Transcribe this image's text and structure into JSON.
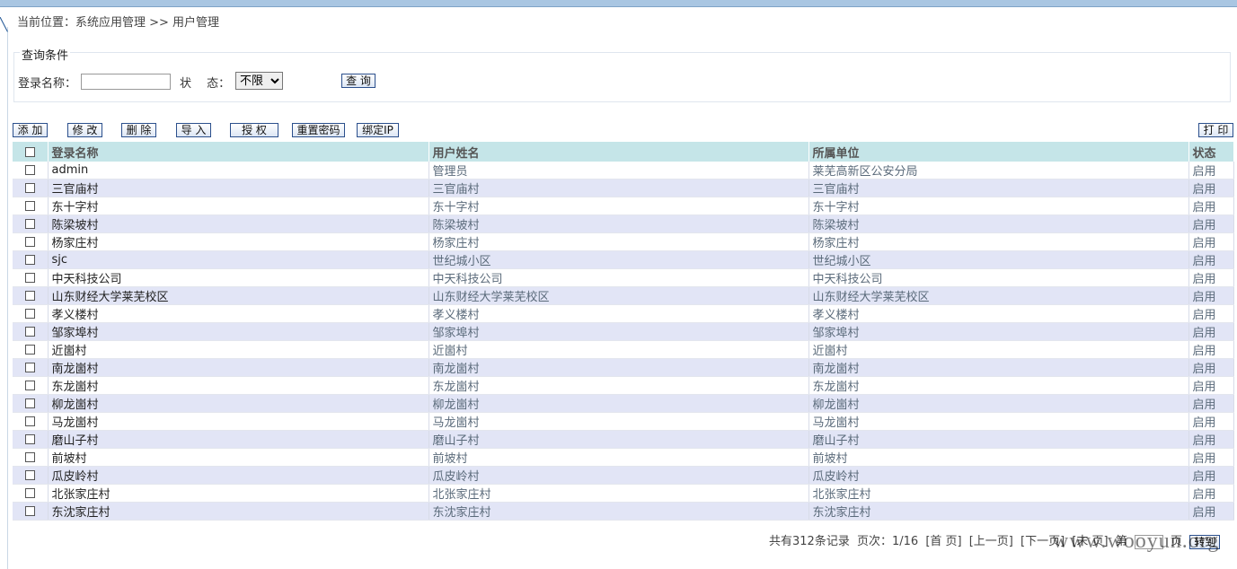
{
  "breadcrumb": "当前位置：系统应用管理 >> 用户管理",
  "query": {
    "legend": "查询条件",
    "login_label": "登录名称：",
    "login_value": "",
    "status_label": "状　 态：",
    "status_selected": "不限",
    "search_button": "查 询"
  },
  "toolbar": {
    "add": "添 加",
    "edit": "修 改",
    "delete": "删 除",
    "import": "导 入",
    "authorize": "授 权",
    "reset_password": "重置密码",
    "bind_ip": "绑定IP",
    "print": "打 印"
  },
  "table": {
    "headers": [
      "登录名称",
      "用户姓名",
      "所属单位",
      "状态"
    ],
    "rows": [
      [
        "admin",
        "管理员",
        "莱芜高新区公安分局",
        "启用"
      ],
      [
        "三官庙村",
        "三官庙村",
        "三官庙村",
        "启用"
      ],
      [
        "东十字村",
        "东十字村",
        "东十字村",
        "启用"
      ],
      [
        "陈梁坡村",
        "陈梁坡村",
        "陈梁坡村",
        "启用"
      ],
      [
        "杨家庄村",
        "杨家庄村",
        "杨家庄村",
        "启用"
      ],
      [
        "sjc",
        "世纪城小区",
        "世纪城小区",
        "启用"
      ],
      [
        "中天科技公司",
        "中天科技公司",
        "中天科技公司",
        "启用"
      ],
      [
        "山东财经大学莱芜校区",
        "山东财经大学莱芜校区",
        "山东财经大学莱芜校区",
        "启用"
      ],
      [
        "孝义楼村",
        "孝义楼村",
        "孝义楼村",
        "启用"
      ],
      [
        "邹家埠村",
        "邹家埠村",
        "邹家埠村",
        "启用"
      ],
      [
        "近崮村",
        "近崮村",
        "近崮村",
        "启用"
      ],
      [
        "南龙崮村",
        "南龙崮村",
        "南龙崮村",
        "启用"
      ],
      [
        "东龙崮村",
        "东龙崮村",
        "东龙崮村",
        "启用"
      ],
      [
        "柳龙崮村",
        "柳龙崮村",
        "柳龙崮村",
        "启用"
      ],
      [
        "马龙崮村",
        "马龙崮村",
        "马龙崮村",
        "启用"
      ],
      [
        "磨山子村",
        "磨山子村",
        "磨山子村",
        "启用"
      ],
      [
        "前坡村",
        "前坡村",
        "前坡村",
        "启用"
      ],
      [
        "瓜皮岭村",
        "瓜皮岭村",
        "瓜皮岭村",
        "启用"
      ],
      [
        "北张家庄村",
        "北张家庄村",
        "北张家庄村",
        "启用"
      ],
      [
        "东沈家庄村",
        "东沈家庄村",
        "东沈家庄村",
        "启用"
      ]
    ]
  },
  "pager": {
    "total": "共有312条记录",
    "page_info": "页次：1/16",
    "first": "[首 页]",
    "prev": "[上一页]",
    "next": "[下一页]",
    "last": "[末 页]",
    "goto_prefix": "第",
    "goto_suffix": "页",
    "jump": "转到"
  },
  "watermark": "www.wooyun.org"
}
